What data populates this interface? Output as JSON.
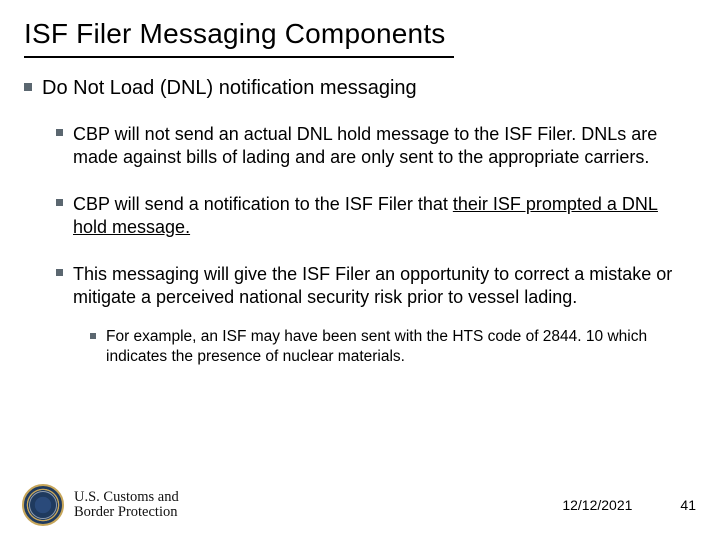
{
  "title": "ISF Filer Messaging Components",
  "bullets": {
    "level1": "Do Not Load (DNL) notification messaging",
    "level2": [
      "CBP will not send an actual DNL hold message to the ISF Filer. DNLs are made against bills of lading and are only sent to the appropriate carriers.",
      {
        "pre": "CBP will send a notification to the ISF Filer that ",
        "underlined": "their ISF prompted a DNL hold message.",
        "post": ""
      },
      "This messaging will give the ISF Filer an opportunity to correct a mistake or mitigate a perceived national security risk prior to vessel lading."
    ],
    "level3": [
      "For example, an ISF may have been sent with the HTS code of 2844. 10 which indicates the presence of nuclear materials."
    ]
  },
  "footer": {
    "agency_line1": "U.S. Customs and",
    "agency_line2": "Border Protection",
    "date": "12/12/2021",
    "page": "41"
  }
}
